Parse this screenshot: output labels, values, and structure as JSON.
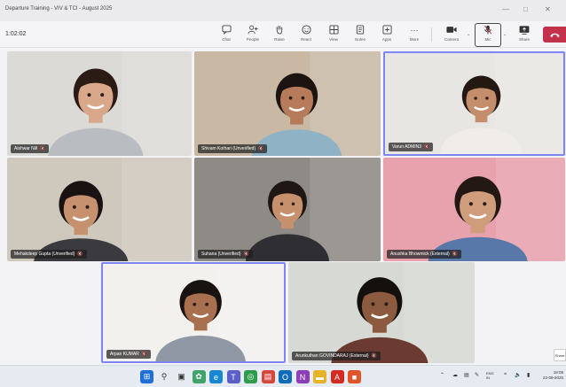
{
  "window": {
    "title": "Departure Training - VIV & TCI - August 2025",
    "controls": [
      "minimize",
      "restore",
      "close"
    ]
  },
  "toolbar": {
    "timer": "1:02:02",
    "buttons": [
      {
        "id": "chat",
        "label": "Chat",
        "icon": "chat-icon"
      },
      {
        "id": "people",
        "label": "People",
        "icon": "people-icon"
      },
      {
        "id": "raise",
        "label": "Raise",
        "icon": "raise-hand-icon"
      },
      {
        "id": "react",
        "label": "React",
        "icon": "react-icon"
      },
      {
        "id": "view",
        "label": "View",
        "icon": "view-icon"
      },
      {
        "id": "notes",
        "label": "Notes",
        "icon": "notes-icon"
      },
      {
        "id": "apps",
        "label": "Apps",
        "icon": "apps-icon"
      },
      {
        "id": "more",
        "label": "More",
        "icon": "more-icon"
      }
    ],
    "camera_label": "Camera",
    "mic_label": "Mic",
    "share_label": "Share",
    "leave_icon": "phone-hangup-icon",
    "leave_color": "#c4314b"
  },
  "participants": [
    {
      "name": "Aishwar Nill",
      "active": false,
      "bg": "#dcdad6",
      "skin": "#d9a88a",
      "hair": "#2a1b14",
      "shirt": "#b9bcc0"
    },
    {
      "name": "Shivam Kothari (Unverified)",
      "active": false,
      "bg": "#c9b9a4",
      "skin": "#b57b5b",
      "hair": "#1c1410",
      "shirt": "#8fb2c4"
    },
    {
      "name": "Varun ADMIN3",
      "active": true,
      "bg": "#e8e6e2",
      "skin": "#c48d6c",
      "hair": "#241812",
      "shirt": "#f0ede8"
    },
    {
      "name": "Mehakdeep Gupta (Unverified)",
      "active": false,
      "bg": "#cfc8bd",
      "skin": "#c6916f",
      "hair": "#1a1210",
      "shirt": "#3a3a3f"
    },
    {
      "name": "Suhana (Unverified)",
      "active": false,
      "bg": "#8e8a86",
      "skin": "#c7906c",
      "hair": "#1e1612",
      "shirt": "#2f2e33"
    },
    {
      "name": "Anushka Bhowmick (External)",
      "active": false,
      "bg": "#e7a2ad",
      "skin": "#cf9c7c",
      "hair": "#231814",
      "shirt": "#5778a8"
    },
    {
      "name": "Arpan KUMAR",
      "active": true,
      "bg": "#f3f1ee",
      "skin": "#a8704f",
      "hair": "#181210",
      "shirt": "#8f98a4"
    },
    {
      "name": "Arunkuthan GOVINDARAJ (External)",
      "active": false,
      "bg": "#d7d9d4",
      "skin": "#8c5a3e",
      "hair": "#14100e",
      "shirt": "#6b3b32"
    }
  ],
  "share_tray_label": "Share",
  "taskbar": {
    "apps": [
      {
        "icon": "windows-start-icon",
        "color": "#1f6fd6"
      },
      {
        "icon": "search-icon",
        "color": "#4a4a4a"
      },
      {
        "icon": "task-view-icon",
        "color": "#3a3a3a"
      },
      {
        "icon": "copilot-icon",
        "color": "#3fa36b"
      },
      {
        "icon": "edge-browser-icon",
        "color": "#1787d4"
      },
      {
        "icon": "teams-icon",
        "color": "#5b5fc7"
      },
      {
        "icon": "chrome-icon",
        "color": "#2e9c4a"
      },
      {
        "icon": "store-icon",
        "color": "#d6463a"
      },
      {
        "icon": "outlook-icon",
        "color": "#0f6cbd"
      },
      {
        "icon": "onenote-icon",
        "color": "#8c3db8"
      },
      {
        "icon": "file-explorer-icon",
        "color": "#e6b227"
      },
      {
        "icon": "acrobat-icon",
        "color": "#d42a1f"
      },
      {
        "icon": "office-icon",
        "color": "#e0542a"
      }
    ],
    "tray_language": "ENG\nIN",
    "clock_time": "18:08",
    "clock_date": "22-08-2025"
  }
}
